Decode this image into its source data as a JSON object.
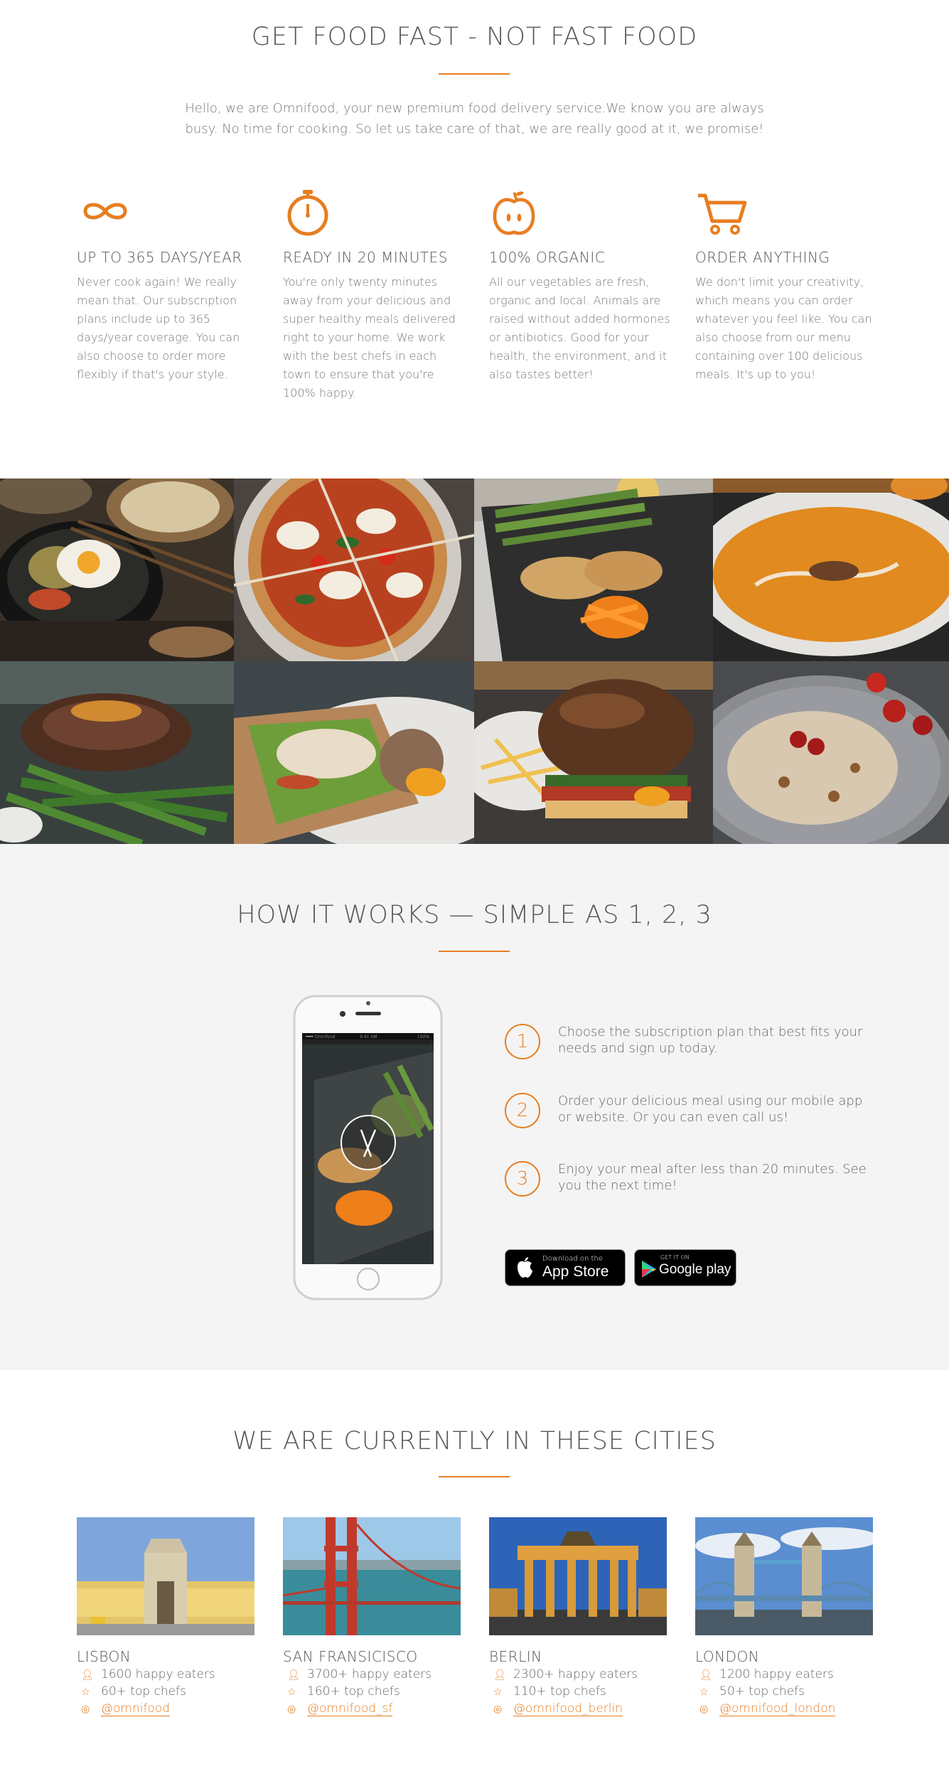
{
  "features": {
    "title": "GET FOOD FAST - NOT FAST FOOD",
    "intro": "Hello, we are Omnifood, your new premium food delivery service.We know you are always busy. No time for cooking. So let us take care of that, we are really good at it, we promise!",
    "items": [
      {
        "icon": "infinity-icon",
        "title": "UP TO 365 DAYS/YEAR",
        "text": "Never cook again! We really mean that. Our subscription plans include up to 365 days/year coverage. You can also choose to order more flexibly if that's your style."
      },
      {
        "icon": "stopwatch-icon",
        "title": "READY IN 20 MINUTES",
        "text": "You're only twenty minutes away from your delicious and super healthy meals delivered right to your home. We work with the best chefs in each town to ensure that you're 100% happy."
      },
      {
        "icon": "apple-icon",
        "title": "100% ORGANIC",
        "text": "All our vegetables are fresh, organic and local. Animals are raised without added hormones or antibiotics. Good for your health, the environment, and it also tastes better!"
      },
      {
        "icon": "cart-icon",
        "title": "ORDER ANYTHING",
        "text": "We don't limit your creativity, which means you can order whatever you feel like. You can also choose from our menu containing over 100 delicious meals. It's up to you!"
      }
    ]
  },
  "how": {
    "title": "HOW IT WORKS — SIMPLE AS 1, 2, 3",
    "steps": [
      {
        "num": "1",
        "text": "Choose the subscription plan that best fits your needs and sign up today."
      },
      {
        "num": "2",
        "text": "Order your delicious meal using our mobile app or website. Or you can even call us!"
      },
      {
        "num": "3",
        "text": "Enjoy your meal after less than 20 minutes. See you the next time!"
      }
    ],
    "phone": {
      "carrier": "••••• Omnifood",
      "time": "9:41 AM",
      "battery": "100%"
    },
    "appstore": {
      "small": "Download on the",
      "big": "App Store"
    },
    "googleplay": {
      "small": "GET IT ON",
      "big": "Google play"
    }
  },
  "cities": {
    "title": "WE ARE CURRENTLY IN THESE CITIES",
    "items": [
      {
        "name": "LISBON",
        "eaters": "1600 happy eaters",
        "chefs": "60+ top chefs",
        "handle": "@omnifood"
      },
      {
        "name": "SAN FRANSICISCO",
        "eaters": "3700+ happy eaters",
        "chefs": "160+ top chefs",
        "handle": "@omnifood_sf"
      },
      {
        "name": "BERLIN",
        "eaters": "2300+ happy eaters",
        "chefs": "110+ top chefs",
        "handle": "@omnifood_berlin"
      },
      {
        "name": "LONDON",
        "eaters": "1200 happy eaters",
        "chefs": "50+ top chefs",
        "handle": "@omnifood_london"
      }
    ]
  },
  "colors": {
    "accent": "#e67e22",
    "section_bg": "#f4f4f4"
  }
}
